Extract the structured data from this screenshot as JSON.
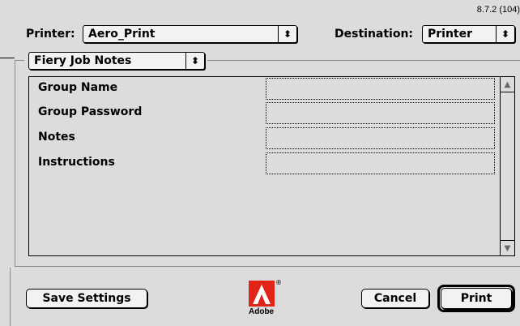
{
  "version": "8.7.2 (104)",
  "printer": {
    "label": "Printer:",
    "value": "Aero_Print"
  },
  "destination": {
    "label": "Destination:",
    "value": "Printer"
  },
  "panel_select": {
    "value": "Fiery Job Notes"
  },
  "fields": [
    {
      "label": "Group Name",
      "value": ""
    },
    {
      "label": "Group Password",
      "value": ""
    },
    {
      "label": "Notes",
      "value": ""
    },
    {
      "label": "Instructions",
      "value": ""
    }
  ],
  "buttons": {
    "save": "Save Settings",
    "cancel": "Cancel",
    "print": "Print"
  },
  "logo": {
    "text": "Adobe",
    "mark": "®"
  },
  "icons": {
    "popup_arrow": "up-down-arrow-icon",
    "scroll_up": "scroll-up-arrow-icon",
    "scroll_down": "scroll-down-arrow-icon",
    "logo": "adobe-logo-icon"
  },
  "colors": {
    "background": "#dcdcdc",
    "logo_red": "#e2231a"
  }
}
